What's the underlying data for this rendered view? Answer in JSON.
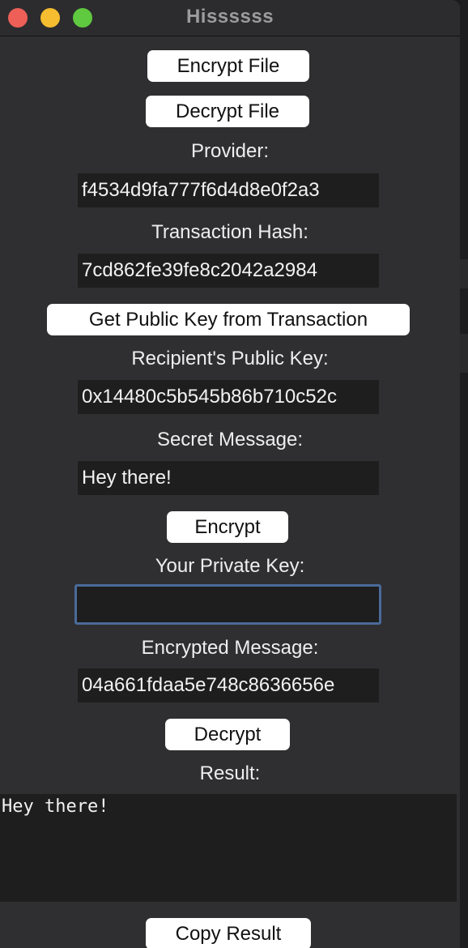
{
  "window": {
    "title": "Hissssss"
  },
  "buttons": {
    "encrypt_file": "Encrypt File",
    "decrypt_file": "Decrypt File",
    "get_public_key": "Get Public Key from Transaction",
    "encrypt": "Encrypt",
    "decrypt": "Decrypt",
    "copy_result": "Copy Result"
  },
  "labels": {
    "provider": "Provider:",
    "transaction_hash": "Transaction Hash:",
    "recipient_public_key": "Recipient's Public Key:",
    "secret_message": "Secret Message:",
    "private_key": "Your Private Key:",
    "encrypted_message": "Encrypted Message:",
    "result": "Result:"
  },
  "fields": {
    "provider": "f4534d9fa777f6d4d8e0f2a3",
    "transaction_hash": "7cd862fe39fe8c2042a2984",
    "recipient_public_key": "0x14480c5b545b86b710c52c",
    "secret_message": "Hey there!",
    "private_key": "",
    "encrypted_message": "04a661fdaa5e748c8636656e"
  },
  "result_text": "Hey there!",
  "colors": {
    "window_bg": "#2f2f31",
    "field_bg": "#1e1e1e",
    "focus_ring": "#4a6a9a",
    "close": "#ee5f57",
    "minimize": "#f5bd2f",
    "maximize": "#5fc93f"
  }
}
